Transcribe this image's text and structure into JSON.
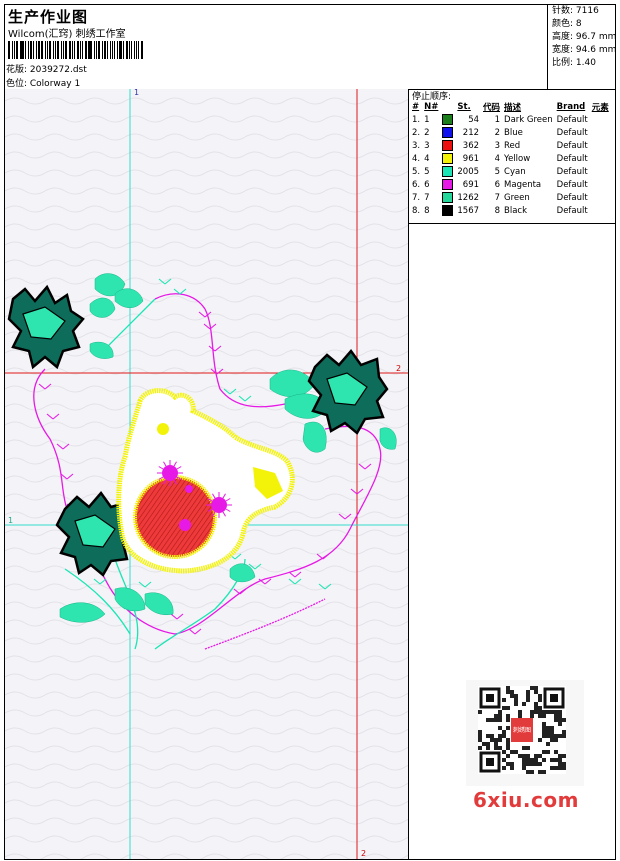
{
  "header": {
    "title": "生产作业图",
    "company": "Wilcom(汇窍) 刺绣工作室",
    "design_label": "花版: 2039272.dst",
    "colorway_label": "色位:  Colorway 1"
  },
  "stats": [
    {
      "label": "针数",
      "value": "7116"
    },
    {
      "label": "颜色",
      "value": "8"
    },
    {
      "label": "高度",
      "value": "96.7 mm"
    },
    {
      "label": "宽度",
      "value": "94.6 mm"
    },
    {
      "label": "比例",
      "value": "1.40"
    }
  ],
  "stop_sequence": {
    "title": "停止顺序:",
    "columns": [
      "#",
      "N#",
      "St.",
      "代码",
      "描述",
      "Brand",
      "元素"
    ],
    "rows": [
      {
        "idx": "1.",
        "n": "1",
        "color": "#1a7f1a",
        "st": "54",
        "code": "1",
        "desc": "Dark Green",
        "brand": "Default"
      },
      {
        "idx": "2.",
        "n": "2",
        "color": "#1010ee",
        "st": "212",
        "code": "2",
        "desc": "Blue",
        "brand": "Default"
      },
      {
        "idx": "3.",
        "n": "3",
        "color": "#ee1010",
        "st": "362",
        "code": "3",
        "desc": "Red",
        "brand": "Default"
      },
      {
        "idx": "4.",
        "n": "4",
        "color": "#f3f30a",
        "st": "961",
        "code": "4",
        "desc": "Yellow",
        "brand": "Default"
      },
      {
        "idx": "5.",
        "n": "5",
        "color": "#19e6b4",
        "st": "2005",
        "code": "5",
        "desc": "Cyan",
        "brand": "Default"
      },
      {
        "idx": "6.",
        "n": "6",
        "color": "#e619e6",
        "st": "691",
        "code": "6",
        "desc": "Magenta",
        "brand": "Default"
      },
      {
        "idx": "7.",
        "n": "7",
        "color": "#24d79a",
        "st": "1262",
        "code": "7",
        "desc": "Green",
        "brand": "Default"
      },
      {
        "idx": "8.",
        "n": "8",
        "color": "#000000",
        "st": "1567",
        "code": "8",
        "desc": "Black",
        "brand": "Default"
      }
    ]
  },
  "guides": {
    "vertical_1": "1",
    "vertical_2": "2",
    "horizontal_1": "1",
    "horizontal_2": "2"
  },
  "colors": {
    "guide_cyan": "#33dccc",
    "guide_red": "#e01a1a",
    "watermark": "#e23b3b"
  },
  "watermark": {
    "text": "6xiu.com",
    "stamp": "刺绣图"
  }
}
